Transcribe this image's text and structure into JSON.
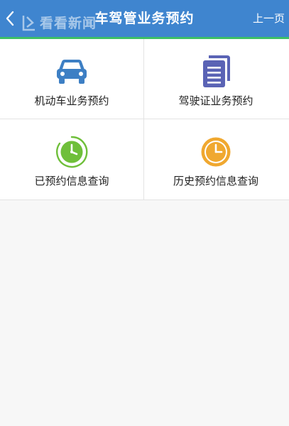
{
  "header": {
    "title": "车驾管业务预约",
    "prev_label": "上一页",
    "back_icon": "chevron-left-icon",
    "watermark_text": "看看新闻",
    "color": "#3f85cf",
    "accent_color": "#3dbf66"
  },
  "menu": {
    "items": [
      {
        "label": "机动车业务预约",
        "icon": "car-icon",
        "color": "#3d7fc4"
      },
      {
        "label": "驾驶证业务预约",
        "icon": "document-icon",
        "color": "#5a63b5"
      },
      {
        "label": "已预约信息查询",
        "icon": "clock-green-icon",
        "color": "#6fbf3a"
      },
      {
        "label": "历史预约信息查询",
        "icon": "clock-orange-icon",
        "color": "#f0a830"
      }
    ]
  }
}
